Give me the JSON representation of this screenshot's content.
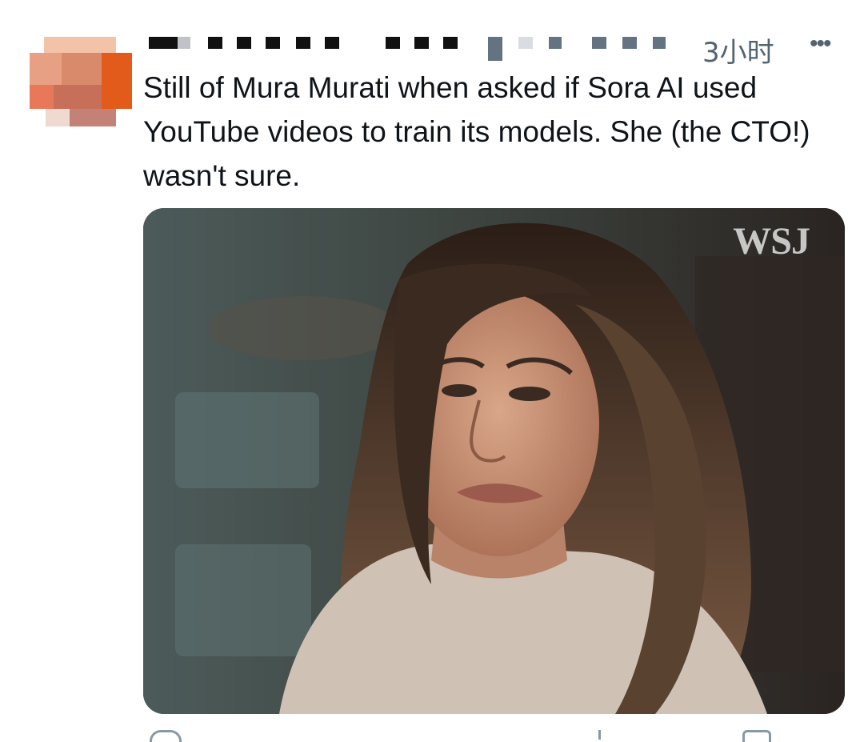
{
  "tweet": {
    "timestamp": "3小时",
    "more_icon": "more-horizontal-icon",
    "text": "Still of Mura Murati when asked if Sora AI used YouTube videos to train its models. She (the CTO!) wasn't sure.",
    "media": {
      "watermark": "WSJ"
    }
  },
  "avatar": {
    "colors": [
      "#f5b69a",
      "#e0855f",
      "#c9674a",
      "#e25a1c",
      "#f2d2c4"
    ]
  }
}
